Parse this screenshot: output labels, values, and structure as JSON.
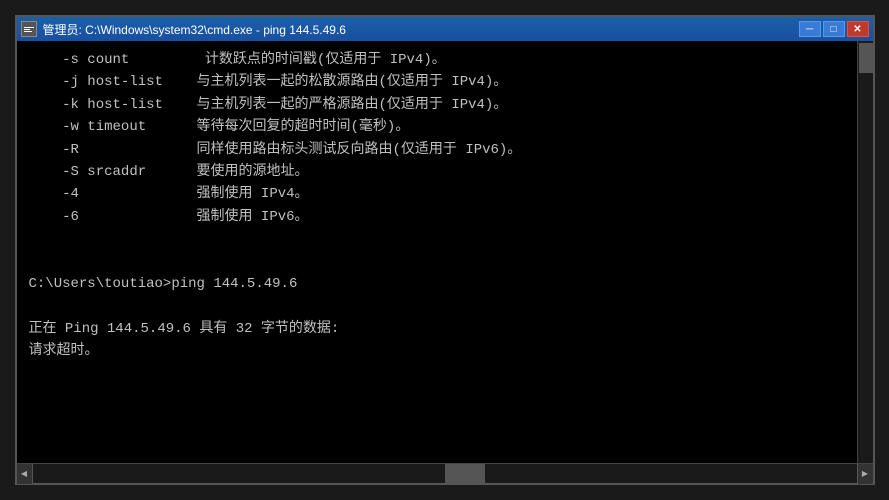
{
  "window": {
    "title": "管理员: C:\\Windows\\system32\\cmd.exe - ping  144.5.49.6",
    "icon": "cmd-icon"
  },
  "controls": {
    "minimize": "─",
    "maximize": "□",
    "close": "✕"
  },
  "terminal": {
    "content_lines": [
      "    -s count         计数跃点的时间戳(仅适用于 IPv4)。",
      "    -j host-list    与主机列表一起的松散源路由(仅适用于 IPv4)。",
      "    -k host-list    与主机列表一起的严格源路由(仅适用于 IPv4)。",
      "    -w timeout      等待每次回复的超时时间(毫秒)。",
      "    -R              同样使用路由标头测试反向路由(仅适用于 IPv6)。",
      "    -S srcaddr      要使用的源地址。",
      "    -4              强制使用 IPv4。",
      "    -6              强制使用 IPv6。",
      "",
      "",
      "C:\\Users\\toutiao>ping 144.5.49.6",
      "",
      "正在 Ping 144.5.49.6 具有 32 字节的数据:",
      "请求超时。"
    ]
  }
}
